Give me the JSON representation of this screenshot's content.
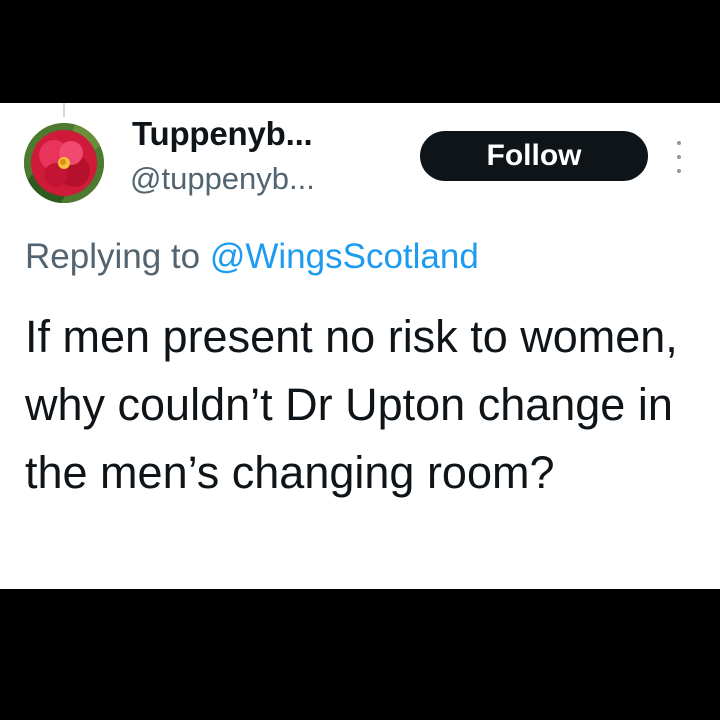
{
  "tweet": {
    "display_name": "Tuppenyb...",
    "handle": "@tuppenyb...",
    "follow_label": "Follow",
    "replying_prefix": "Replying to",
    "replying_to": "@WingsScotland",
    "text": "If men present no risk to women, why couldn’t Dr Upton change in the men’s changing room?"
  },
  "icons": {
    "more": "more-vertical-icon",
    "avatar": "red-flower-avatar"
  },
  "colors": {
    "follow_button": "#0f1419",
    "mention": "#1d9bf0",
    "secondary_text": "#536471",
    "text": "#0f1419"
  }
}
